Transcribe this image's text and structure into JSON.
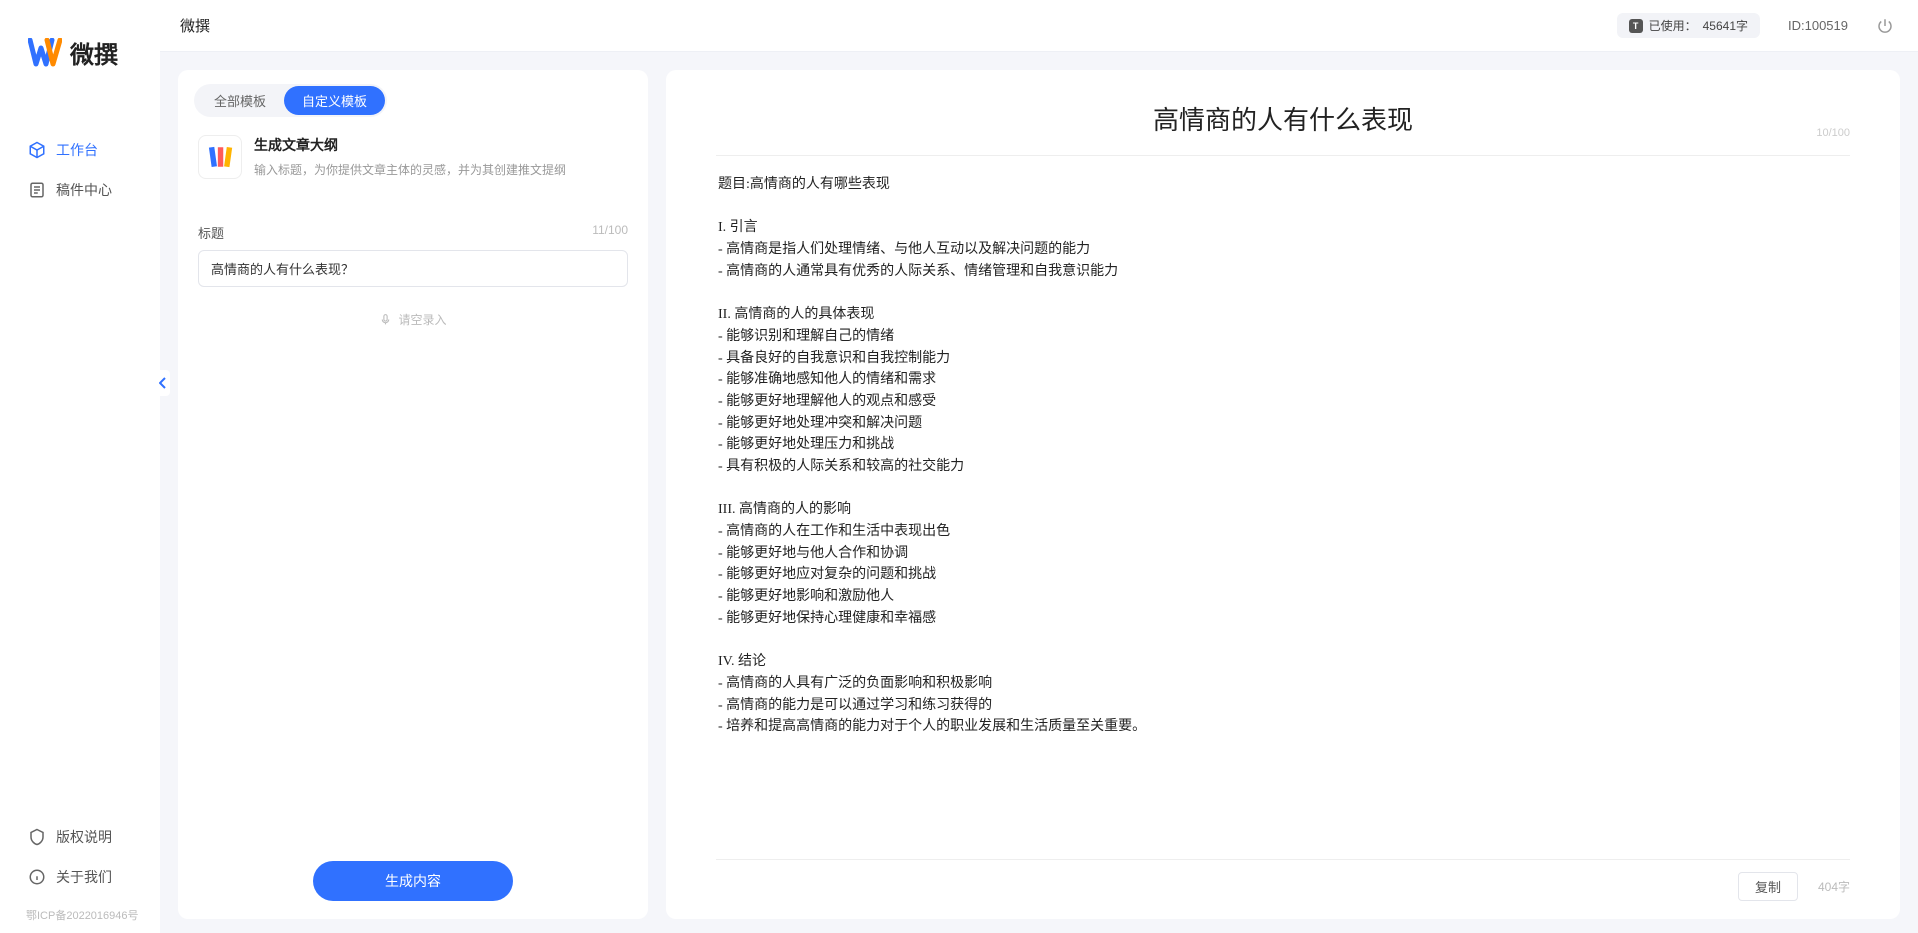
{
  "brand": {
    "name": "微撰"
  },
  "topbar": {
    "title": "微撰",
    "usage_prefix": "已使用：",
    "usage_value": "45641字",
    "id_label": "ID:100519"
  },
  "sidebar": {
    "items": [
      {
        "label": "工作台",
        "icon": "cube-icon",
        "active": true
      },
      {
        "label": "稿件中心",
        "icon": "document-icon",
        "active": false
      }
    ],
    "bottom": [
      {
        "label": "版权说明",
        "icon": "shield-icon"
      },
      {
        "label": "关于我们",
        "icon": "info-icon"
      }
    ],
    "icp": "鄂ICP备2022016946号"
  },
  "tabs": {
    "all": "全部模板",
    "custom": "自定义模板"
  },
  "template": {
    "title": "生成文章大纲",
    "desc": "输入标题，为你提供文章主体的灵感，并为其创建推文提纲"
  },
  "form": {
    "title_label": "标题",
    "title_count": "11/100",
    "title_value": "高情商的人有什么表现？",
    "voice_label": "请空录入",
    "generate_label": "生成内容"
  },
  "output": {
    "title": "高情商的人有什么表现",
    "title_count": "10/100",
    "body": "题目:高情商的人有哪些表现\n\nI. 引言\n- 高情商是指人们处理情绪、与他人互动以及解决问题的能力\n- 高情商的人通常具有优秀的人际关系、情绪管理和自我意识能力\n\nII. 高情商的人的具体表现\n- 能够识别和理解自己的情绪\n- 具备良好的自我意识和自我控制能力\n- 能够准确地感知他人的情绪和需求\n- 能够更好地理解他人的观点和感受\n- 能够更好地处理冲突和解决问题\n- 能够更好地处理压力和挑战\n- 具有积极的人际关系和较高的社交能力\n\nIII. 高情商的人的影响\n- 高情商的人在工作和生活中表现出色\n- 能够更好地与他人合作和协调\n- 能够更好地应对复杂的问题和挑战\n- 能够更好地影响和激励他人\n- 能够更好地保持心理健康和幸福感\n\nIV. 结论\n- 高情商的人具有广泛的负面影响和积极影响\n- 高情商的能力是可以通过学习和练习获得的\n- 培养和提高高情商的能力对于个人的职业发展和生活质量至关重要。",
    "copy_label": "复制",
    "char_count": "404字"
  }
}
